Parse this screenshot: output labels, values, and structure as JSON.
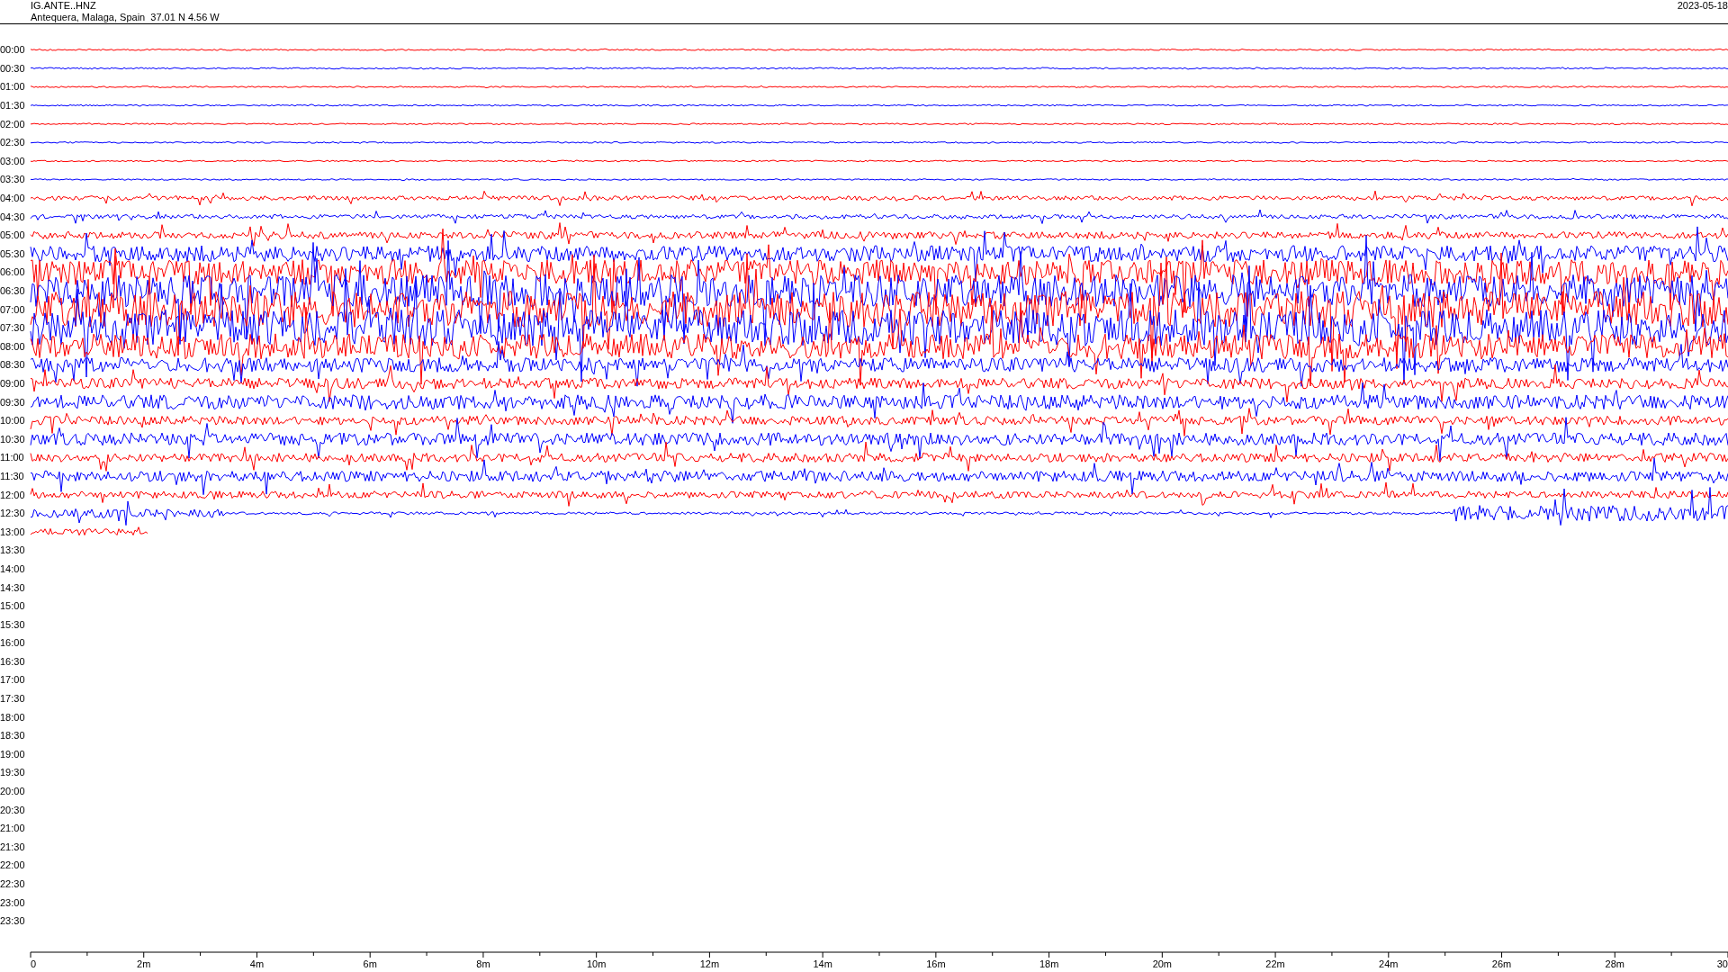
{
  "header": {
    "station": "IG.ANTE..HNZ",
    "location": "Antequera, Malaga, Spain  37.01 N 4.56 W",
    "date": "2023-05-18"
  },
  "rows": [
    {
      "label": "00:00",
      "color": "#ff0000"
    },
    {
      "label": "00:30",
      "color": "#0000ff"
    },
    {
      "label": "01:00",
      "color": "#ff0000"
    },
    {
      "label": "01:30",
      "color": "#0000ff"
    },
    {
      "label": "02:00",
      "color": "#ff0000"
    },
    {
      "label": "02:30",
      "color": "#0000ff"
    },
    {
      "label": "03:00",
      "color": "#ff0000"
    },
    {
      "label": "03:30",
      "color": "#0000ff"
    },
    {
      "label": "04:00",
      "color": "#ff0000"
    },
    {
      "label": "04:30",
      "color": "#0000ff"
    },
    {
      "label": "05:00",
      "color": "#ff0000"
    },
    {
      "label": "05:30",
      "color": "#0000ff"
    },
    {
      "label": "06:00",
      "color": "#ff0000"
    },
    {
      "label": "06:30",
      "color": "#0000ff"
    },
    {
      "label": "07:00",
      "color": "#ff0000"
    },
    {
      "label": "07:30",
      "color": "#0000ff"
    },
    {
      "label": "08:00",
      "color": "#ff0000"
    },
    {
      "label": "08:30",
      "color": "#0000ff"
    },
    {
      "label": "09:00",
      "color": "#ff0000"
    },
    {
      "label": "09:30",
      "color": "#0000ff"
    },
    {
      "label": "10:00",
      "color": "#ff0000"
    },
    {
      "label": "10:30",
      "color": "#0000ff"
    },
    {
      "label": "11:00",
      "color": "#ff0000"
    },
    {
      "label": "11:30",
      "color": "#0000ff"
    },
    {
      "label": "12:00",
      "color": "#ff0000"
    },
    {
      "label": "12:30",
      "color": "#0000ff"
    },
    {
      "label": "13:00",
      "color": "#ff0000"
    },
    {
      "label": "13:30"
    },
    {
      "label": "14:00"
    },
    {
      "label": "14:30"
    },
    {
      "label": "15:00"
    },
    {
      "label": "15:30"
    },
    {
      "label": "16:00"
    },
    {
      "label": "16:30"
    },
    {
      "label": "17:00"
    },
    {
      "label": "17:30"
    },
    {
      "label": "18:00"
    },
    {
      "label": "18:30"
    },
    {
      "label": "19:00"
    },
    {
      "label": "19:30"
    },
    {
      "label": "20:00"
    },
    {
      "label": "20:30"
    },
    {
      "label": "21:00"
    },
    {
      "label": "21:30"
    },
    {
      "label": "22:00"
    },
    {
      "label": "22:30"
    },
    {
      "label": "23:00"
    },
    {
      "label": "23:30"
    }
  ],
  "x_axis": {
    "labels": [
      "0",
      "2m",
      "4m",
      "6m",
      "8m",
      "10m",
      "12m",
      "14m",
      "16m",
      "18m",
      "20m",
      "22m",
      "24m",
      "26m",
      "28m",
      "30"
    ]
  }
}
